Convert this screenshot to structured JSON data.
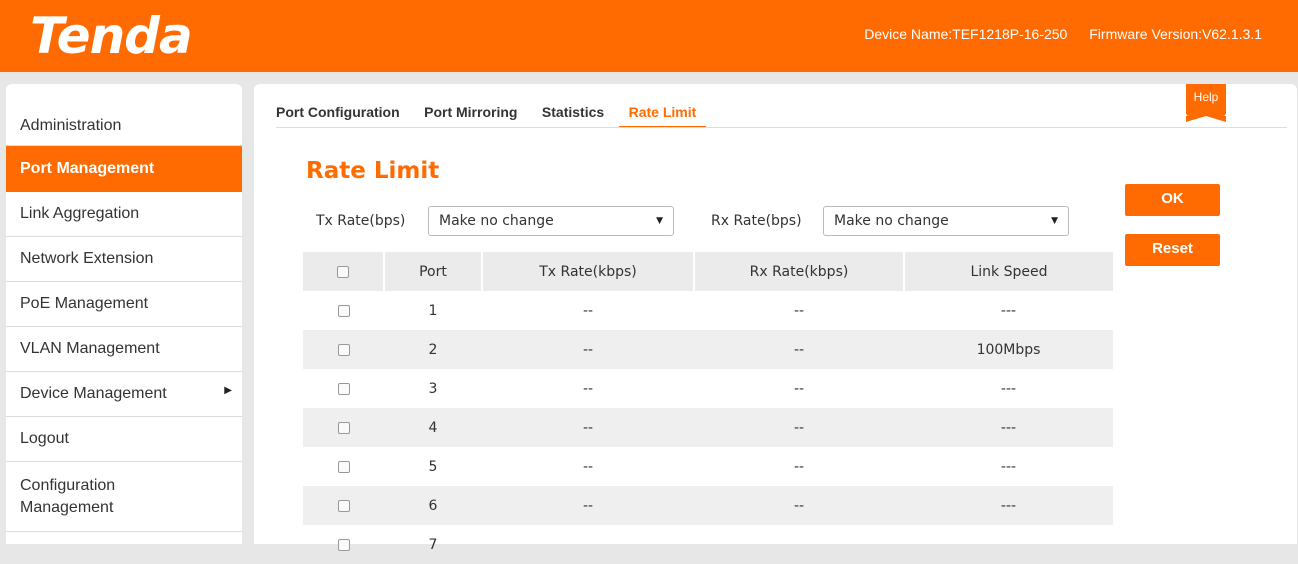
{
  "header": {
    "logo": "Tenda",
    "device_name": "Device Name:TEF1218P-16-250",
    "firmware_version": "Firmware Version:V62.1.3.1",
    "bg_color": "#ff6b00"
  },
  "sidebar": {
    "items": [
      {
        "label": "Administration"
      },
      {
        "label": "Port Management"
      },
      {
        "label": "Link Aggregation"
      },
      {
        "label": "Network Extension"
      },
      {
        "label": "PoE Management"
      },
      {
        "label": "VLAN Management"
      },
      {
        "label": "Device Management",
        "arrow": "▶"
      },
      {
        "label": "Logout"
      },
      {
        "label": "Configuration Management"
      }
    ]
  },
  "tabs": [
    {
      "label": "Port Configuration"
    },
    {
      "label": "Port Mirroring"
    },
    {
      "label": "Statistics"
    },
    {
      "label": "Rate Limit"
    }
  ],
  "help_label": "Help",
  "page_title": "Rate Limit",
  "tx": {
    "label": "Tx Rate(bps)",
    "value": "Make no change"
  },
  "rx": {
    "label": "Rx Rate(bps)",
    "value": "Make no change"
  },
  "buttons": {
    "ok": "OK",
    "reset": "Reset"
  },
  "table": {
    "headers": [
      "Port",
      "Tx Rate(kbps)",
      "Rx Rate(kbps)",
      "Link Speed"
    ],
    "rows": [
      {
        "port": "1",
        "tx": "--",
        "rx": "--",
        "speed": "---"
      },
      {
        "port": "2",
        "tx": "--",
        "rx": "--",
        "speed": "100Mbps"
      },
      {
        "port": "3",
        "tx": "--",
        "rx": "--",
        "speed": "---"
      },
      {
        "port": "4",
        "tx": "--",
        "rx": "--",
        "speed": "---"
      },
      {
        "port": "5",
        "tx": "--",
        "rx": "--",
        "speed": "---"
      },
      {
        "port": "6",
        "tx": "--",
        "rx": "--",
        "speed": "---"
      },
      {
        "port": "7",
        "tx": "",
        "rx": "",
        "speed": ""
      }
    ]
  }
}
